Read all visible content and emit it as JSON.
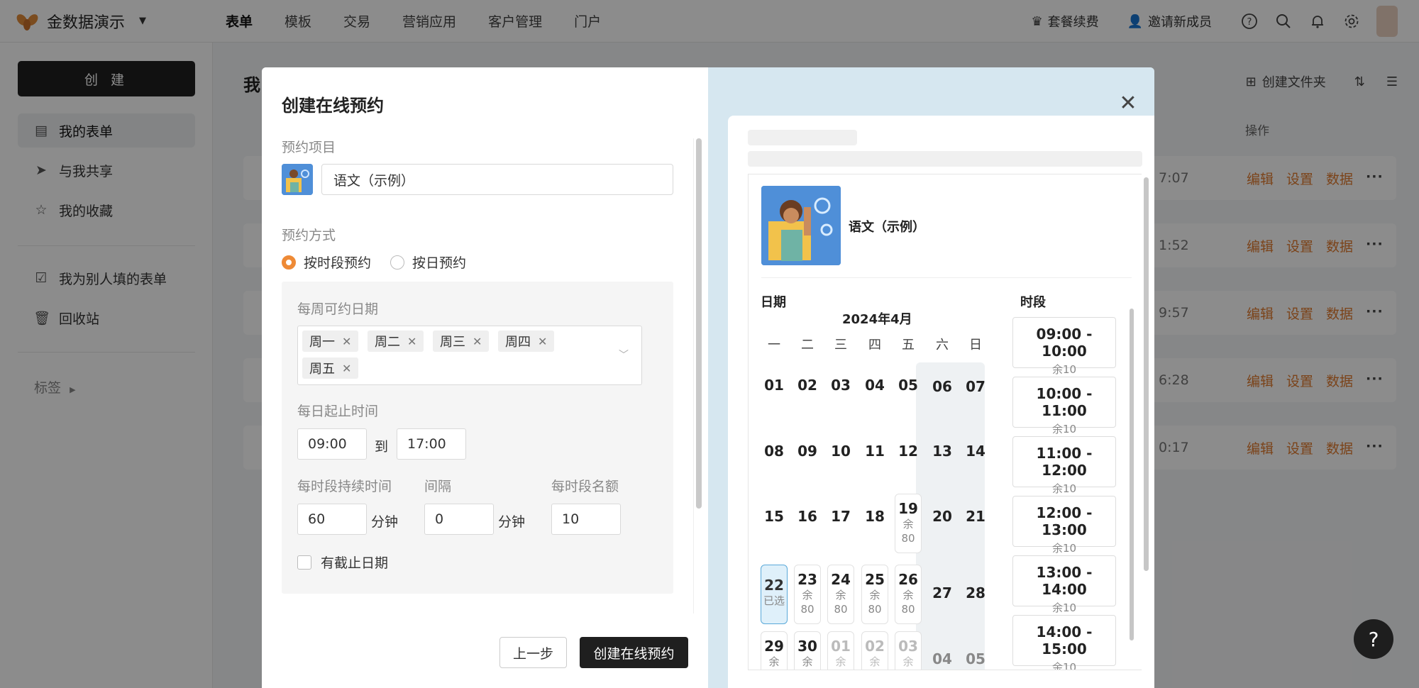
{
  "app": {
    "brand_name": "金数据演示",
    "nav": [
      "表单",
      "模板",
      "交易",
      "营销应用",
      "客户管理",
      "门户"
    ],
    "renew": "套餐续费",
    "invite": "邀请新成员"
  },
  "sidebar": {
    "create": "创 建",
    "items": [
      "我的表单",
      "与我共享",
      "我的收藏",
      "我为别人填的表单",
      "回收站"
    ],
    "tags": "标签"
  },
  "main": {
    "title": "我",
    "create_folder": "创建文件夹",
    "ops_header": "操作",
    "rows": [
      {
        "time": "7:07"
      },
      {
        "time": "1:52"
      },
      {
        "time": "9:57"
      },
      {
        "time": "6:28"
      },
      {
        "time": "0:17"
      }
    ],
    "ops": {
      "edit": "编辑",
      "settings": "设置",
      "data": "数据",
      "more": "···"
    }
  },
  "modal": {
    "title": "创建在线预约",
    "project_label": "预约项目",
    "project_name": "语文（示例）",
    "method_label": "预约方式",
    "method_options": [
      "按时段预约",
      "按日预约"
    ],
    "weekly_label": "每周可约日期",
    "weekdays": [
      "周一",
      "周二",
      "周三",
      "周四",
      "周五"
    ],
    "daily_label": "每日起止时间",
    "start_time": "09:00",
    "to": "到",
    "end_time": "17:00",
    "duration_label": "每时段持续时间",
    "duration": "60",
    "interval_label": "间隔",
    "interval": "0",
    "minute": "分钟",
    "quota_label": "每时段名额",
    "quota": "10",
    "deadline_label": "有截止日期",
    "prev": "上一步",
    "submit": "创建在线预约"
  },
  "preview": {
    "project_name": "语文（示例）",
    "date_section": "日期",
    "time_section": "时段",
    "month": "2024年4月",
    "weekdays": [
      "一",
      "二",
      "三",
      "四",
      "五",
      "六",
      "日"
    ],
    "weeks": [
      [
        "01",
        "02",
        "03",
        "04",
        "05",
        "06",
        "07"
      ],
      [
        "08",
        "09",
        "10",
        "11",
        "12",
        "13",
        "14"
      ],
      [
        "15",
        "16",
        "17",
        "18",
        "19",
        "20",
        "21"
      ],
      [
        "22",
        "23",
        "24",
        "25",
        "26",
        "27",
        "28"
      ],
      [
        "29",
        "30",
        "01",
        "02",
        "03",
        "04",
        "05"
      ]
    ],
    "available": [
      {
        "day": "19",
        "remain": "余",
        "count": "80"
      },
      {
        "day": "23",
        "remain": "余",
        "count": "80"
      },
      {
        "day": "24",
        "remain": "余",
        "count": "80"
      },
      {
        "day": "25",
        "remain": "余",
        "count": "80"
      },
      {
        "day": "26",
        "remain": "余",
        "count": "80"
      },
      {
        "day": "29",
        "remain": "余",
        "count": ""
      },
      {
        "day": "30",
        "remain": "余",
        "count": ""
      },
      {
        "day": "01",
        "remain": "余",
        "count": ""
      },
      {
        "day": "02",
        "remain": "余",
        "count": ""
      },
      {
        "day": "03",
        "remain": "余",
        "count": ""
      }
    ],
    "selected_day": "22",
    "selected_text": "已选",
    "slots": [
      {
        "time": "09:00 - 10:00",
        "remain": "余10"
      },
      {
        "time": "10:00 - 11:00",
        "remain": "余10"
      },
      {
        "time": "11:00 - 12:00",
        "remain": "余10"
      },
      {
        "time": "12:00 - 13:00",
        "remain": "余10"
      },
      {
        "time": "13:00 - 14:00",
        "remain": "余10"
      },
      {
        "time": "14:00 - 15:00",
        "remain": "余10"
      }
    ]
  },
  "colors": {
    "accent": "#ee8a36",
    "dark": "#1f1f1f",
    "preview_bg": "#d6e7f0"
  }
}
